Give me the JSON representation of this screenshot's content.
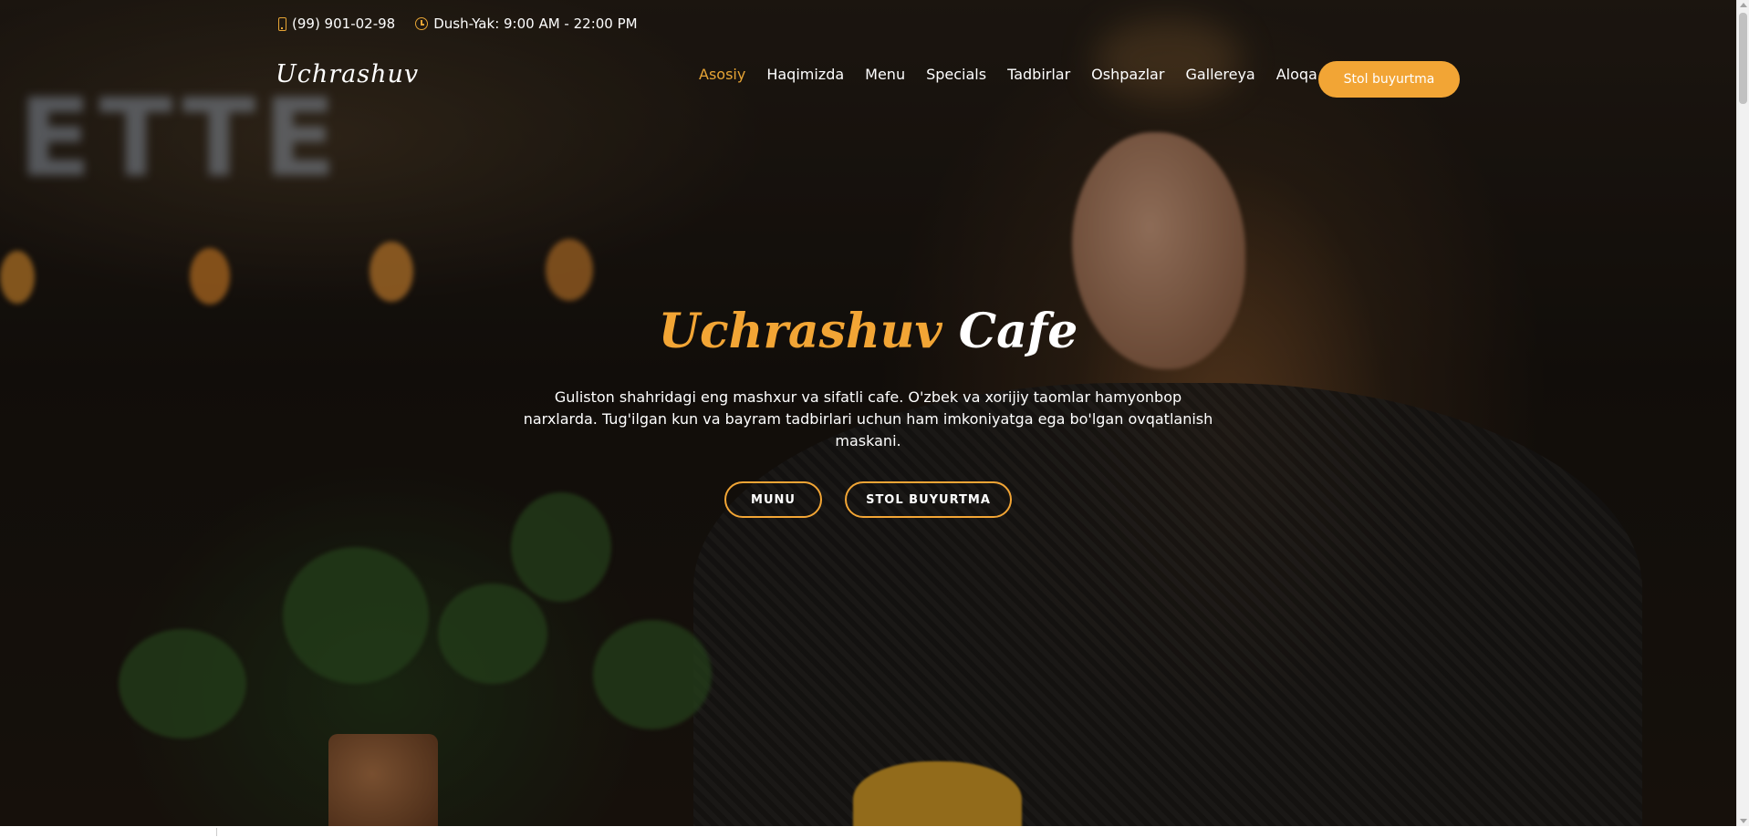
{
  "topbar": {
    "phone": "(99) 901-02-98",
    "hours": "Dush-Yak: 9:00 AM - 22:00 PM",
    "phone_icon": "phone-icon",
    "hours_icon": "clock-icon"
  },
  "header": {
    "logo": "Uchrashuv",
    "nav": [
      {
        "label": "Asosiy",
        "active": true
      },
      {
        "label": "Haqimizda"
      },
      {
        "label": "Menu"
      },
      {
        "label": "Specials"
      },
      {
        "label": "Tadbirlar"
      },
      {
        "label": "Oshpazlar"
      },
      {
        "label": "Gallereya"
      },
      {
        "label": "Aloqa"
      }
    ],
    "cta": "Stol buyurtma"
  },
  "hero": {
    "title_brand": "Uchrashuv",
    "title_rest": "Cafe",
    "description": "Guliston shahridagi eng mashxur va sifatli cafe. O'zbek va xorijiy taomlar hamyonbop narxlarda. Tug'ilgan kun va bayram tadbirlari uchun ham imkoniyatga ega bo'lgan ovqatlanish maskani.",
    "buttons": {
      "menu": "MUNU",
      "order": "STOL BUYURTMA"
    }
  },
  "colors": {
    "accent": "#f2a535",
    "text": "#ffffff"
  }
}
